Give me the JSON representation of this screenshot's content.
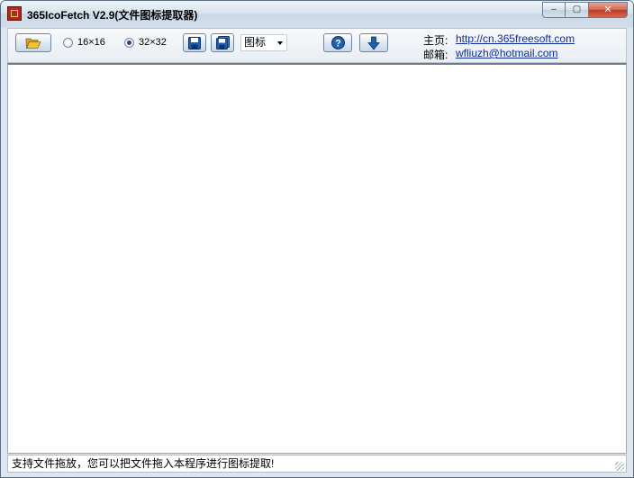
{
  "window": {
    "title": "365IcoFetch V2.9(文件图标提取器)",
    "controls": {
      "minimize": "‒",
      "maximize": "▢",
      "close": "✕"
    }
  },
  "toolbar": {
    "open_icon": "folder-open-icon",
    "size_options": [
      {
        "label": "16×16",
        "selected": false
      },
      {
        "label": "32×32",
        "selected": true
      }
    ],
    "save_icon": "floppy-disk-icon",
    "save_all_icon": "floppy-disk-multi-icon",
    "format_select": {
      "value": "图标"
    },
    "help_icon": "help-question-icon",
    "download_icon": "arrow-down-icon"
  },
  "contact": {
    "homepage_label": "主页:",
    "homepage_url": "http://cn.365freesoft.com",
    "email_label": "邮箱:",
    "email": "wfliuzh@hotmail.com"
  },
  "statusbar": {
    "text": "支持文件拖放，您可以把文件拖入本程序进行图标提取!"
  },
  "colors": {
    "link": "#0d2b9c",
    "button_icon_blue": "#1f5fb0",
    "folder_yellow": "#f2c23a"
  }
}
